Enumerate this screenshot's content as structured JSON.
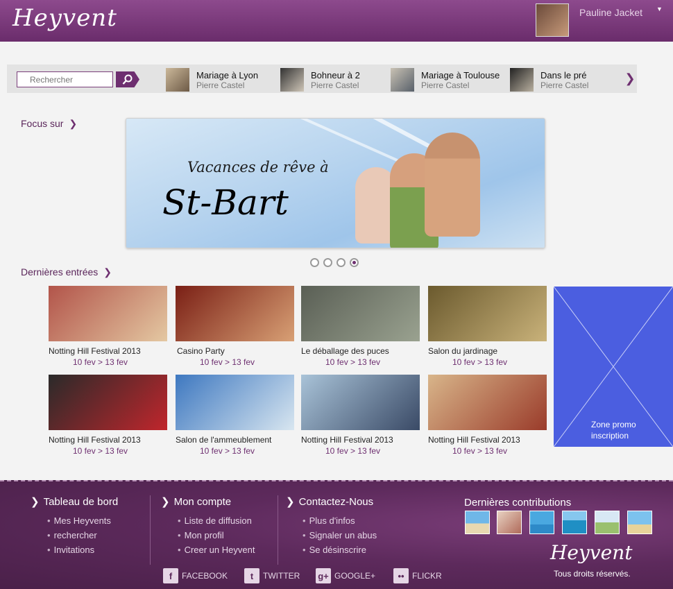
{
  "header": {
    "logo_text": "Heyvent",
    "user_name": "Pauline Jacket"
  },
  "search": {
    "placeholder": "Rechercher"
  },
  "recent_events": [
    {
      "title": "Mariage à Lyon",
      "author": "Pierre Castel"
    },
    {
      "title": "Bohneur à 2",
      "author": "Pierre Castel"
    },
    {
      "title": "Mariage à Toulouse",
      "author": "Pierre Castel"
    },
    {
      "title": "Dans le pré",
      "author": "Pierre Castel"
    }
  ],
  "focus": {
    "title": "Focus sur",
    "banner_line1": "Vacances de rêve à",
    "banner_line2": "St-Bart",
    "slides_count": 4,
    "active_slide": 4
  },
  "latest": {
    "title": "Dernières entrées",
    "cards": [
      {
        "name": "Notting Hill Festival 2013",
        "date": "10 fev > 13 fev",
        "colors": [
          "#b2544a",
          "#e4c8a2"
        ]
      },
      {
        "name": "Casino Party",
        "date": "10 fev > 13 fev",
        "colors": [
          "#7a1f15",
          "#d8a075"
        ]
      },
      {
        "name": "Le déballage des puces",
        "date": "10 fev > 13 fev",
        "colors": [
          "#5a5f55",
          "#9aa290"
        ]
      },
      {
        "name": "Salon du jardinage",
        "date": "10 fev > 13 fev",
        "colors": [
          "#6b5a2e",
          "#c9b27a"
        ]
      },
      {
        "name": "Notting Hill Festival 2013",
        "date": "10 fev > 13 fev",
        "colors": [
          "#2a2a2a",
          "#c0262c"
        ]
      },
      {
        "name": "Salon de l'ammeublement",
        "date": "10 fev > 13 fev",
        "colors": [
          "#3e78c0",
          "#d8e6f0"
        ]
      },
      {
        "name": "Notting Hill Festival 2013",
        "date": "10 fev > 13 fev",
        "colors": [
          "#a9c3d8",
          "#3a4a66"
        ]
      },
      {
        "name": "Notting Hill Festival 2013",
        "date": "10 fev > 13 fev",
        "colors": [
          "#d8b58a",
          "#9a3b2a"
        ]
      }
    ]
  },
  "promo": {
    "line1": "Zone promo",
    "line2": "inscription",
    "color": "#4b5ee0"
  },
  "footer": {
    "col1": {
      "title": "Tableau de bord",
      "items": [
        "Mes Heyvents",
        "rechercher",
        "Invitations"
      ]
    },
    "col2": {
      "title": "Mon compte",
      "items": [
        "Liste de diffusion",
        "Mon profil",
        "Creer un Heyvent"
      ]
    },
    "col3": {
      "title": "Contactez-Nous",
      "items": [
        "Plus d'infos",
        "Signaler un abus",
        "Se désinscrire"
      ]
    },
    "contrib_title": "Dernières contributions",
    "social": [
      {
        "label": "FACEBOOK",
        "icon": "f"
      },
      {
        "label": "TWITTER",
        "icon": "t"
      },
      {
        "label": "GOOGLE+",
        "icon": "g+"
      },
      {
        "label": "FLICKR",
        "icon": "••"
      }
    ],
    "logo_text": "Heyvent",
    "rights": "Tous droits réservés."
  },
  "colors": {
    "brand": "#6e2f70",
    "footer": "#5d2a5c"
  }
}
